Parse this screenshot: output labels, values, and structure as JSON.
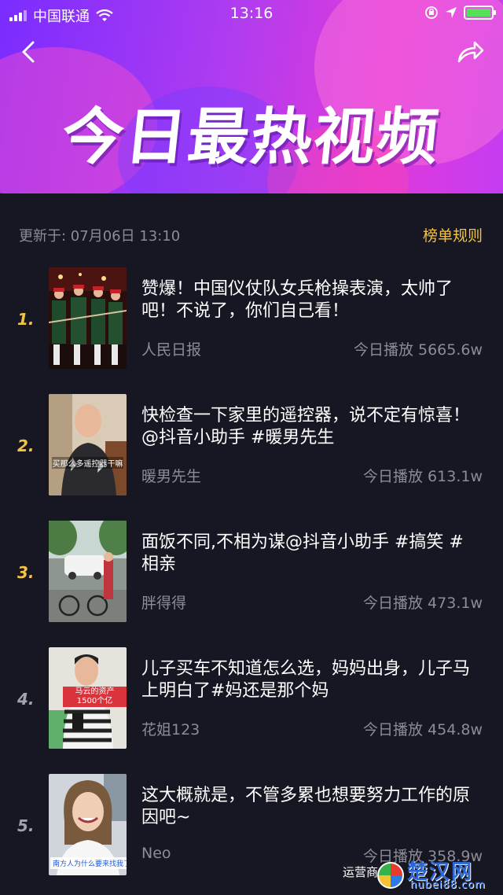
{
  "status_bar": {
    "carrier": "中国联通",
    "time": "13:16"
  },
  "header": {
    "title": "今日最热视频",
    "back_icon": "chevron-left-icon",
    "share_icon": "share-arrow-icon"
  },
  "update": {
    "text": "更新于: 07月06日 13:10",
    "rules_label": "榜单规则"
  },
  "colors": {
    "accent_gold": "#f3c344",
    "background": "#161722",
    "muted_text": "#8b8c96",
    "banner_start": "#7a2cff",
    "banner_end": "#e23ad8"
  },
  "videos": [
    {
      "rank": "1.",
      "title": "赞爆！中国仪仗队女兵枪操表演，太帅了吧！不说了，你们自己看！",
      "author": "人民日报",
      "plays": "今日播放 5665.6w",
      "thumb_caption": ""
    },
    {
      "rank": "2.",
      "title": "快检查一下家里的遥控器，说不定有惊喜！@抖音小助手 #暖男先生",
      "author": "暖男先生",
      "plays": "今日播放 613.1w",
      "thumb_caption": "买那么多遥控器干嘛"
    },
    {
      "rank": "3.",
      "title": "面饭不同,不相为谋@抖音小助手 #搞笑 #相亲",
      "author": "胖得得",
      "plays": "今日播放 473.1w",
      "thumb_caption": ""
    },
    {
      "rank": "4.",
      "title": "儿子买车不知道怎么选，妈妈出身，儿子马上明白了#妈还是那个妈",
      "author": "花姐123",
      "plays": "今日播放 454.8w",
      "thumb_caption": "马云的资产1500个亿"
    },
    {
      "rank": "5.",
      "title": "这大概就是，不管多累也想要努力工作的原因吧~",
      "author": "Neo",
      "plays": "今日播放 358.9w",
      "thumb_caption": "南方人为什么要来找我了呢"
    }
  ],
  "watermark": {
    "brand": "楚汉网",
    "url": "hubei88.com",
    "overlay_text": "运营商"
  }
}
